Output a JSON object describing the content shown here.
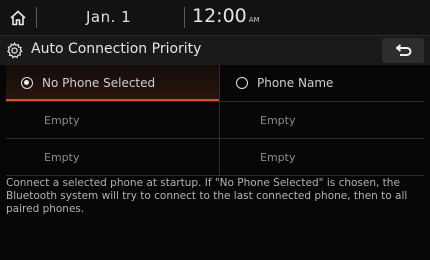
{
  "status": {
    "date": "Jan.  1",
    "time": "12:00",
    "ampm": "AM"
  },
  "title_bar": {
    "title": "Auto Connection Priority"
  },
  "options": {
    "row1_left": "No Phone Selected",
    "row1_right": "Phone Name",
    "row2_left": "Empty",
    "row2_right": "Empty",
    "row3_left": "Empty",
    "row3_right": "Empty"
  },
  "description": "Connect a selected phone at startup. If \"No Phone Selected\" is chosen, the Bluetooth system will try to connect to the last connected phone, then to all paired phones.",
  "colors": {
    "accent": "#d9501c",
    "background": "#060606"
  },
  "icons": [
    "home-icon",
    "gear-icon",
    "back-icon"
  ]
}
